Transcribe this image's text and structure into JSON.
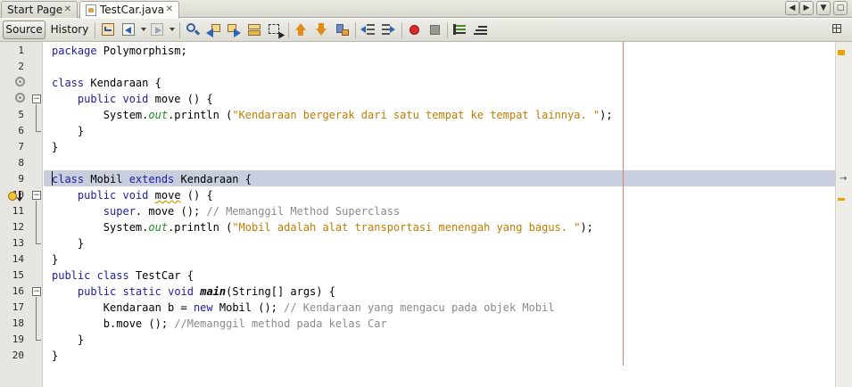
{
  "tabs": [
    {
      "label": "Start Page",
      "active": false
    },
    {
      "label": "TestCar.java",
      "active": true
    }
  ],
  "tab_nav": {
    "prev": "◀",
    "next": "▶",
    "menu": "▼",
    "restore": "▢"
  },
  "toolbar": {
    "source_label": "Source",
    "history_label": "History"
  },
  "editor": {
    "right_marker": "→",
    "lines": [
      {
        "n": "1",
        "text": "package Polymorphism;"
      },
      {
        "n": "2",
        "text": ""
      },
      {
        "n": "3",
        "text": "class Kendaraan {"
      },
      {
        "n": "4",
        "text": "    public void move () {"
      },
      {
        "n": "5",
        "text": "        System.out.println (\"Kendaraan bergerak dari satu tempat ke tempat lainnya. \");"
      },
      {
        "n": "6",
        "text": "    }"
      },
      {
        "n": "7",
        "text": "}"
      },
      {
        "n": "8",
        "text": ""
      },
      {
        "n": "9",
        "text": "class Mobil extends Kendaraan {"
      },
      {
        "n": "10",
        "text": "    public void move () {"
      },
      {
        "n": "11",
        "text": "        super. move (); // Memanggil Method Superclass"
      },
      {
        "n": "12",
        "text": "        System.out.println (\"Mobil adalah alat transportasi menengah yang bagus. \");"
      },
      {
        "n": "13",
        "text": "    }"
      },
      {
        "n": "14",
        "text": "}"
      },
      {
        "n": "15",
        "text": "public class TestCar {"
      },
      {
        "n": "16",
        "text": "    public static void main(String[] args) {"
      },
      {
        "n": "17",
        "text": "        Kendaraan b = new Mobil (); // Kendaraan yang mengacu pada objek Mobil"
      },
      {
        "n": "18",
        "text": "        b.move (); //Memanggil method pada kelas Car"
      },
      {
        "n": "19",
        "text": "    }"
      },
      {
        "n": "20",
        "text": "}"
      }
    ],
    "current_line": 9
  },
  "colors": {
    "keyword": "#1d1d9e",
    "string": "#c27b00",
    "comment": "#8a8a8a",
    "field": "#1f8a23",
    "current_line": "#c8cede",
    "margin_line": "#c9876f",
    "warning_mark": "#e3a400"
  }
}
